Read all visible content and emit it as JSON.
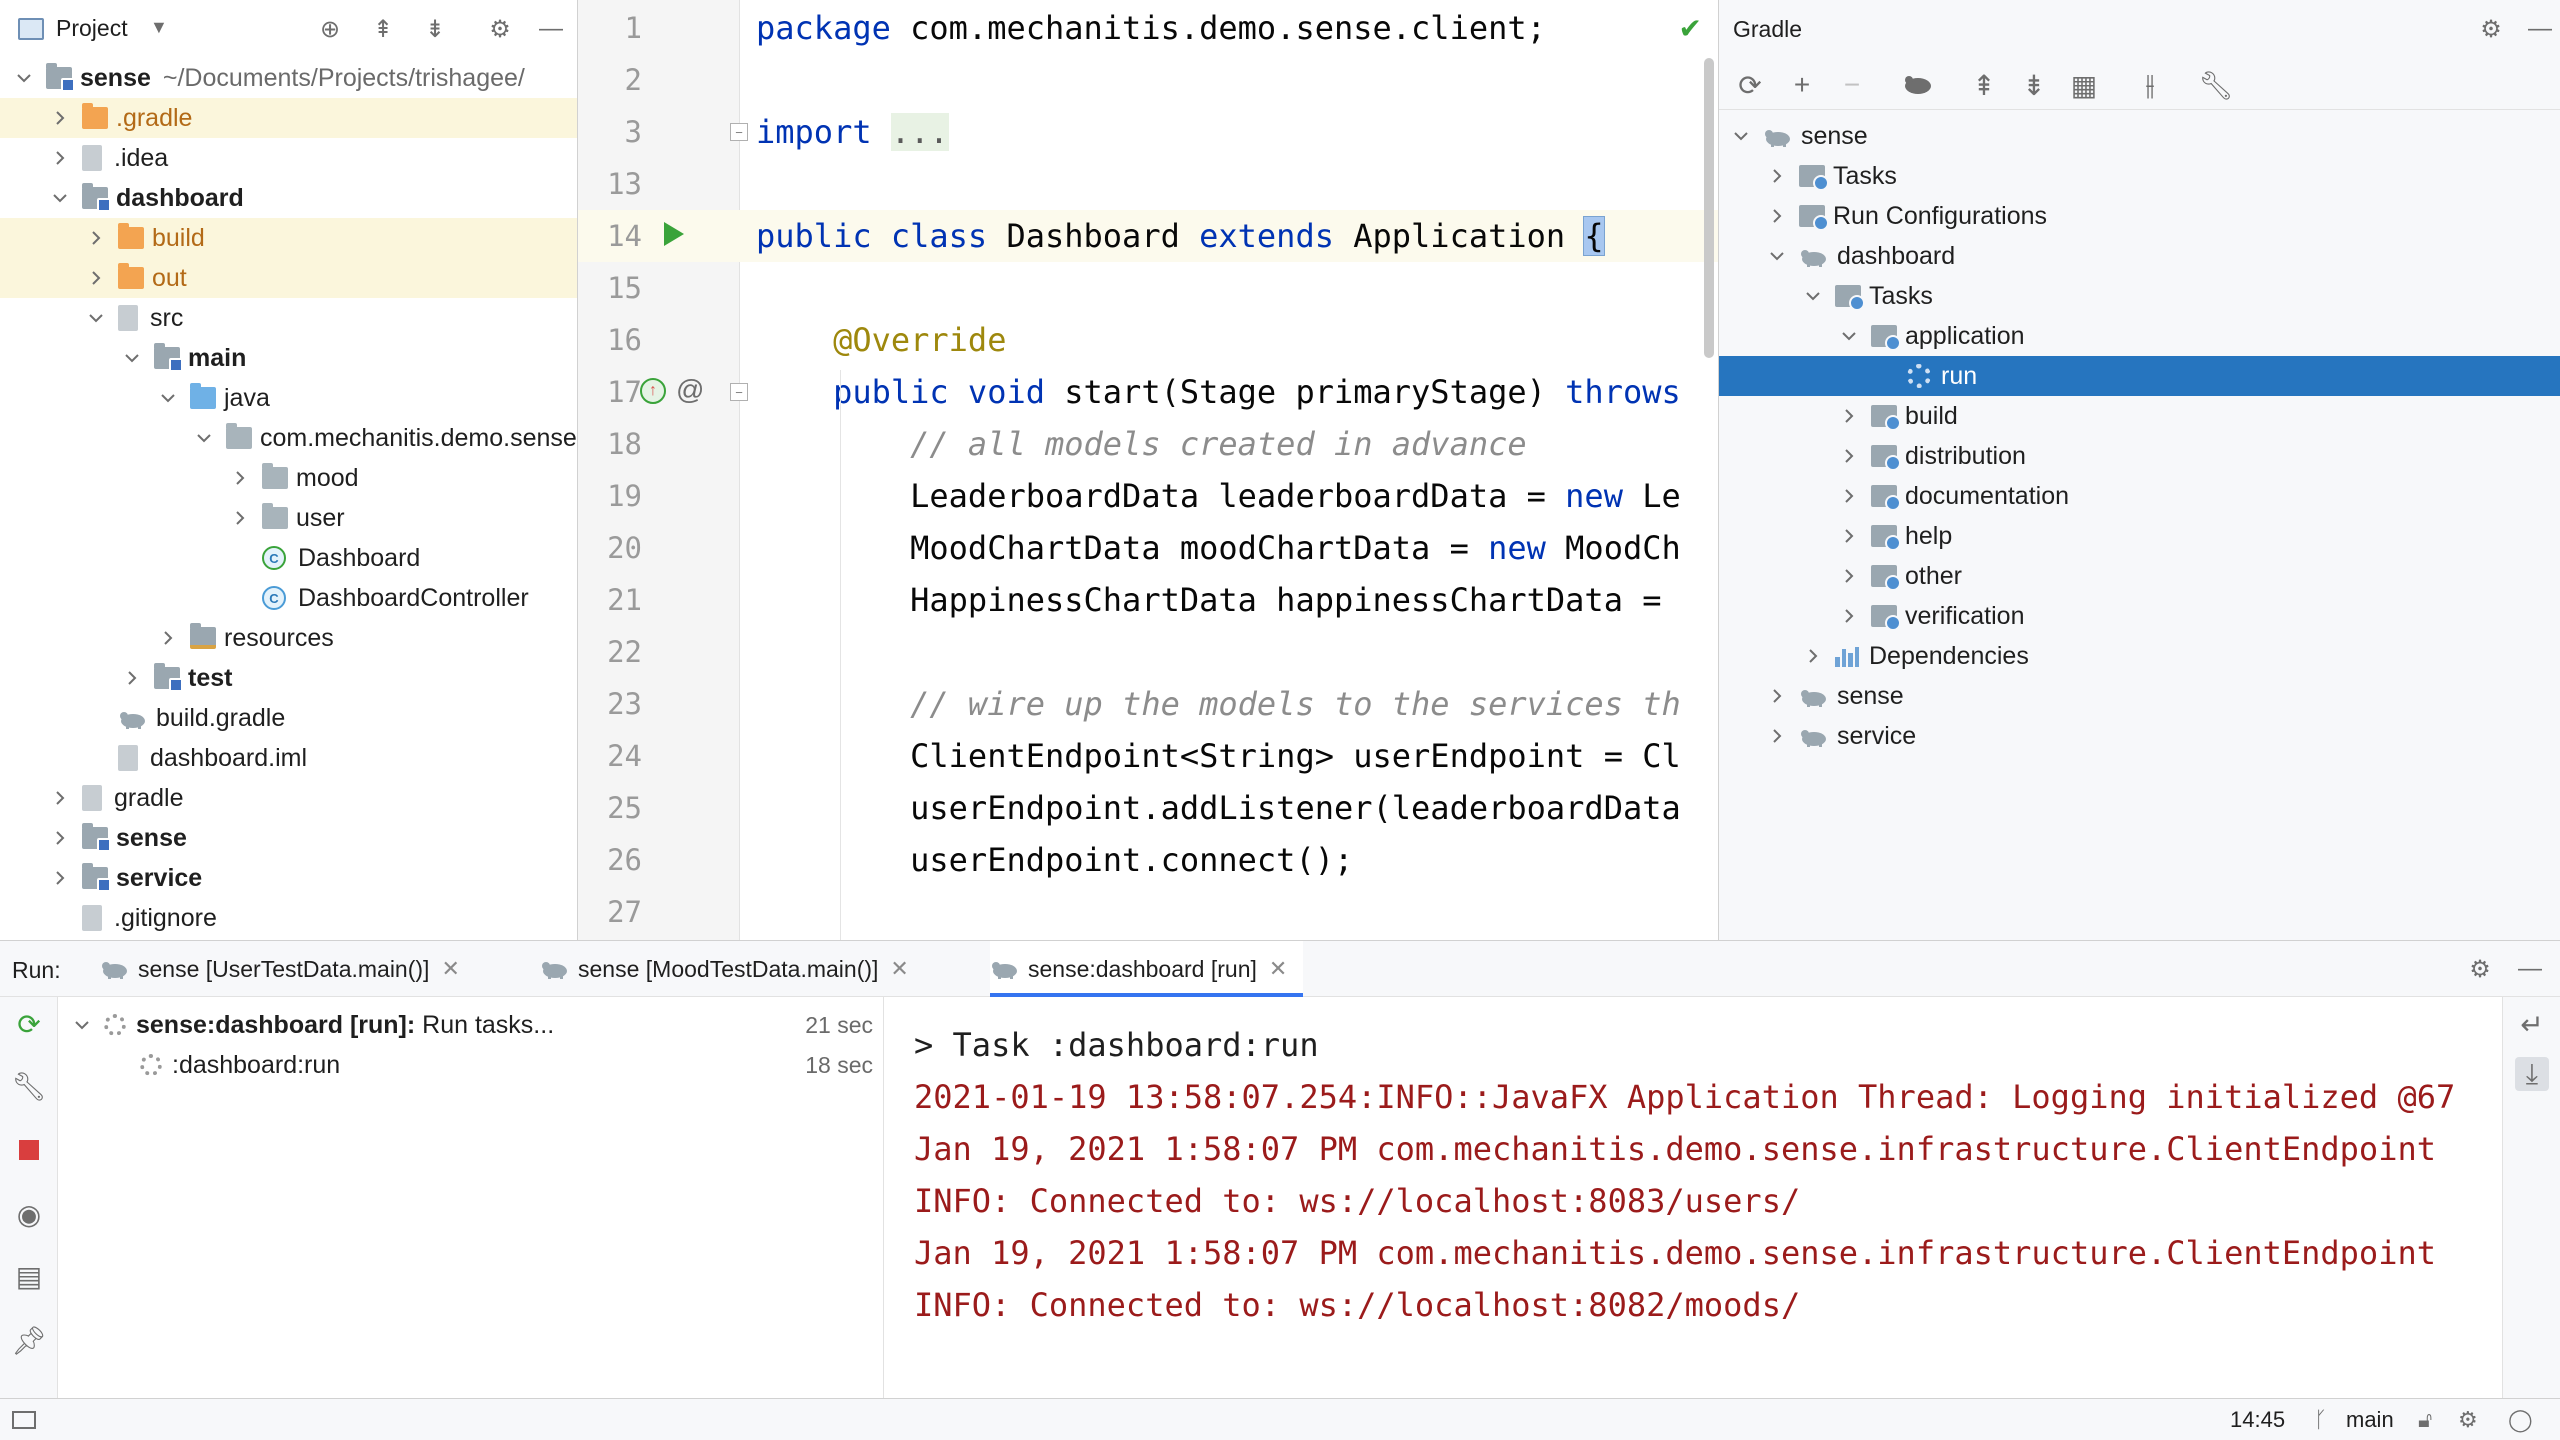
{
  "project": {
    "title": "Project",
    "tree": [
      {
        "label": "sense",
        "path": "~/Documents/Projects/trishagee/",
        "bold": true,
        "expanded": true,
        "level": 0,
        "icon": "module-folder-icon",
        "excluded": false
      },
      {
        "label": ".gradle",
        "level": 1,
        "icon": "excluded-folder-icon",
        "excluded": true,
        "collapsed": true
      },
      {
        "label": ".idea",
        "level": 1,
        "icon": "folder-icon",
        "collapsed": true
      },
      {
        "label": "dashboard",
        "bold": true,
        "level": 1,
        "icon": "module-folder-icon",
        "expanded": true
      },
      {
        "label": "build",
        "level": 2,
        "icon": "excluded-folder-icon",
        "excluded": true,
        "collapsed": true
      },
      {
        "label": "out",
        "level": 2,
        "icon": "excluded-folder-icon",
        "excluded": true,
        "collapsed": true
      },
      {
        "label": "src",
        "level": 2,
        "icon": "folder-icon",
        "expanded": true
      },
      {
        "label": "main",
        "bold": true,
        "level": 3,
        "icon": "module-folder-icon",
        "expanded": true
      },
      {
        "label": "java",
        "level": 4,
        "icon": "source-folder-icon",
        "expanded": true
      },
      {
        "label": "com.mechanitis.demo.sense.client",
        "level": 5,
        "icon": "package-icon",
        "expanded": true
      },
      {
        "label": "mood",
        "level": 6,
        "icon": "package-icon",
        "collapsed": true
      },
      {
        "label": "user",
        "level": 6,
        "icon": "package-icon",
        "collapsed": true
      },
      {
        "label": "Dashboard",
        "level": 6,
        "icon": "javafx-class-icon",
        "leaf": true
      },
      {
        "label": "DashboardController",
        "level": 6,
        "icon": "class-icon",
        "leaf": true
      },
      {
        "label": "resources",
        "level": 4,
        "icon": "resources-folder-icon",
        "collapsed": true
      },
      {
        "label": "test",
        "bold": true,
        "level": 3,
        "icon": "module-folder-icon",
        "collapsed": true
      },
      {
        "label": "build.gradle",
        "level": 2,
        "icon": "gradle-file-icon",
        "leaf": true
      },
      {
        "label": "dashboard.iml",
        "level": 2,
        "icon": "iml-file-icon",
        "leaf": true
      },
      {
        "label": "gradle",
        "level": 1,
        "icon": "folder-icon",
        "collapsed": true
      },
      {
        "label": "sense",
        "bold": true,
        "level": 1,
        "icon": "module-folder-icon",
        "collapsed": true
      },
      {
        "label": "service",
        "bold": true,
        "level": 1,
        "icon": "module-folder-icon",
        "collapsed": true
      },
      {
        "label": ".gitignore",
        "level": 1,
        "icon": "gitignore-file-icon",
        "leaf": true
      }
    ]
  },
  "editor": {
    "lines": [
      {
        "num": "1",
        "parts": [
          {
            "t": "package ",
            "c": "kw"
          },
          {
            "t": "com.mechanitis.demo.sense.client;",
            "c": ""
          }
        ]
      },
      {
        "num": "2",
        "parts": []
      },
      {
        "num": "3",
        "parts": [
          {
            "t": "import ",
            "c": "kw"
          },
          {
            "t": "...",
            "c": "fold"
          }
        ]
      },
      {
        "num": "13",
        "parts": []
      },
      {
        "num": "14",
        "parts": [
          {
            "t": "public class ",
            "c": "kw"
          },
          {
            "t": "Dashboard ",
            "c": ""
          },
          {
            "t": "extends ",
            "c": "kw"
          },
          {
            "t": "Application ",
            "c": ""
          },
          {
            "t": "{",
            "c": "brace"
          }
        ],
        "current": true,
        "run": true
      },
      {
        "num": "15",
        "parts": []
      },
      {
        "num": "16",
        "parts": [
          {
            "t": "    @Override",
            "c": "ann"
          }
        ]
      },
      {
        "num": "17",
        "parts": [
          {
            "t": "    public void ",
            "c": "kw"
          },
          {
            "t": "start(Stage primaryStage) ",
            "c": ""
          },
          {
            "t": "throws",
            "c": "kw"
          }
        ],
        "override": true
      },
      {
        "num": "18",
        "parts": [
          {
            "t": "        // all models created in advance",
            "c": "cmt"
          }
        ]
      },
      {
        "num": "19",
        "parts": [
          {
            "t": "        LeaderboardData leaderboardData = ",
            "c": ""
          },
          {
            "t": "new ",
            "c": "kw"
          },
          {
            "t": "Le",
            "c": ""
          }
        ]
      },
      {
        "num": "20",
        "parts": [
          {
            "t": "        MoodChartData moodChartData = ",
            "c": ""
          },
          {
            "t": "new ",
            "c": "kw"
          },
          {
            "t": "MoodCh",
            "c": ""
          }
        ]
      },
      {
        "num": "21",
        "parts": [
          {
            "t": "        HappinessChartData happinessChartData = ",
            "c": ""
          }
        ]
      },
      {
        "num": "22",
        "parts": []
      },
      {
        "num": "23",
        "parts": [
          {
            "t": "        // wire up the models to the services th",
            "c": "cmt"
          }
        ]
      },
      {
        "num": "24",
        "parts": [
          {
            "t": "        ClientEndpoint<String> userEndpoint = Cl",
            "c": ""
          }
        ]
      },
      {
        "num": "25",
        "parts": [
          {
            "t": "        userEndpoint.addListener(leaderboardData",
            "c": ""
          }
        ]
      },
      {
        "num": "26",
        "parts": [
          {
            "t": "        userEndpoint.connect();",
            "c": ""
          }
        ]
      },
      {
        "num": "27",
        "parts": []
      }
    ]
  },
  "gradle": {
    "title": "Gradle",
    "tree": [
      {
        "label": "sense",
        "level": 0,
        "icon": "gradle-elephant-icon",
        "expanded": true
      },
      {
        "label": "Tasks",
        "level": 1,
        "icon": "task-folder-icon",
        "collapsed": true
      },
      {
        "label": "Run Configurations",
        "level": 1,
        "icon": "task-folder-icon",
        "collapsed": true
      },
      {
        "label": "dashboard",
        "level": 1,
        "icon": "gradle-elephant-icon",
        "expanded": true
      },
      {
        "label": "Tasks",
        "level": 2,
        "icon": "task-folder-icon",
        "expanded": true
      },
      {
        "label": "application",
        "level": 3,
        "icon": "task-folder-icon",
        "expanded": true
      },
      {
        "label": "run",
        "level": 4,
        "icon": "gear-icon",
        "leaf": true,
        "selected": true
      },
      {
        "label": "build",
        "level": 3,
        "icon": "task-folder-icon",
        "collapsed": true
      },
      {
        "label": "distribution",
        "level": 3,
        "icon": "task-folder-icon",
        "collapsed": true
      },
      {
        "label": "documentation",
        "level": 3,
        "icon": "task-folder-icon",
        "collapsed": true
      },
      {
        "label": "help",
        "level": 3,
        "icon": "task-folder-icon",
        "collapsed": true
      },
      {
        "label": "other",
        "level": 3,
        "icon": "task-folder-icon",
        "collapsed": true
      },
      {
        "label": "verification",
        "level": 3,
        "icon": "task-folder-icon",
        "collapsed": true
      },
      {
        "label": "Dependencies",
        "level": 2,
        "icon": "dependencies-icon",
        "collapsed": true
      },
      {
        "label": "sense",
        "level": 1,
        "icon": "gradle-elephant-icon",
        "collapsed": true
      },
      {
        "label": "service",
        "level": 1,
        "icon": "gradle-elephant-icon",
        "collapsed": true
      }
    ]
  },
  "run": {
    "label": "Run:",
    "tabs": [
      {
        "label": "sense [UserTestData.main()]",
        "active": false
      },
      {
        "label": "sense [MoodTestData.main()]",
        "active": false
      },
      {
        "label": "sense:dashboard [run]",
        "active": true
      }
    ],
    "tree": [
      {
        "bold": "sense:dashboard [run]:",
        "rest": " Run tasks...",
        "time": "21 sec",
        "level": 0
      },
      {
        "bold": "",
        "rest": ":dashboard:run",
        "time": "18 sec",
        "level": 1
      }
    ],
    "console": [
      {
        "text": "> Task :dashboard:run",
        "red": false
      },
      {
        "text": "2021-01-19 13:58:07.254:INFO::JavaFX Application Thread: Logging initialized @67",
        "red": true
      },
      {
        "text": "Jan 19, 2021 1:58:07 PM com.mechanitis.demo.sense.infrastructure.ClientEndpoint",
        "red": true
      },
      {
        "text": "INFO: Connected to: ws://localhost:8083/users/",
        "red": true
      },
      {
        "text": "Jan 19, 2021 1:58:07 PM com.mechanitis.demo.sense.infrastructure.ClientEndpoint",
        "red": true
      },
      {
        "text": "INFO: Connected to: ws://localhost:8082/moods/",
        "red": true
      }
    ]
  },
  "status": {
    "time": "14:45",
    "branch": "main"
  },
  "colors": {
    "selection": "#2675bf",
    "keyword": "#0033b3",
    "annotation": "#9e880d",
    "console_error": "#9b1b1b",
    "excluded_bg": "#fbf6dc"
  }
}
